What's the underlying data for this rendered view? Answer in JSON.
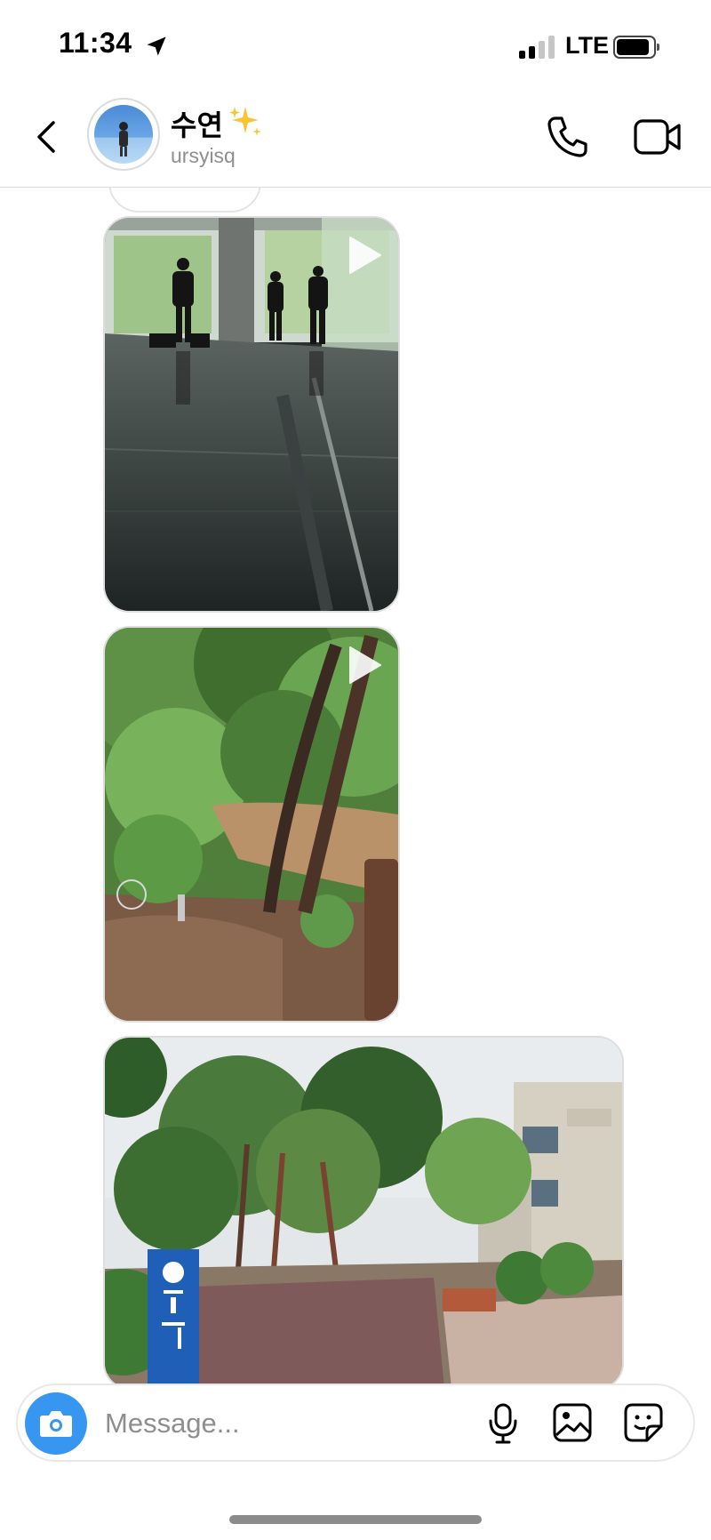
{
  "status_bar": {
    "time": "11:34",
    "network": "LTE",
    "signal_bars": 4,
    "signal_bars_active": 2,
    "icons": [
      "location-arrow-icon",
      "signal-icon",
      "battery-icon"
    ]
  },
  "header": {
    "name": "수연",
    "name_emoji": "sparkles",
    "username": "ursyisq",
    "icons": [
      "back-chevron-icon",
      "phone-icon",
      "video-camera-icon"
    ]
  },
  "messages": [
    {
      "type": "video",
      "scene": "people squeegeeing water off a flooded indoor corridor",
      "icon": "play-icon"
    },
    {
      "type": "video",
      "scene": "muddy floodwater through green trees on a slope",
      "icon": "play-icon"
    },
    {
      "type": "photo",
      "scene": "campus path after flood with fallen trees and blue sign"
    }
  ],
  "composer": {
    "placeholder": "Message...",
    "value": "",
    "icons": [
      "camera-icon",
      "microphone-icon",
      "gallery-icon",
      "sticker-icon"
    ]
  },
  "colors": {
    "accent": "#3797f0",
    "secondary_text": "#8e8e8e",
    "divider": "#dbdbdb"
  }
}
